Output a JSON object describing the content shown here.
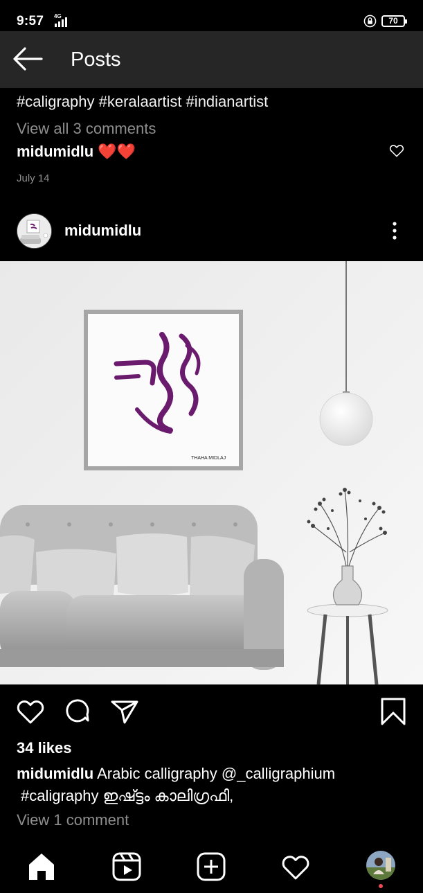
{
  "status_bar": {
    "time": "9:57",
    "network": "4G",
    "battery": "70"
  },
  "header": {
    "title": "Posts",
    "back_icon": "arrow-left-icon"
  },
  "previous_post": {
    "caption_tail": "#caligraphy #keralaartist #indianartist",
    "view_comments": "View all 3 comments",
    "comment_user": "midumidlu",
    "comment_text": "❤️❤️",
    "date": "July 14"
  },
  "post": {
    "username": "midumidlu",
    "image_signature": "THAHA MIDLAJ",
    "likes": "34 likes",
    "caption_user": "midumidlu",
    "caption_text": "Arabic calligraphy @_calligraphium",
    "caption_line2": "#caligraphy ഇഷ്ട്ടം കാലിഗ്രഫി,",
    "view_comment": "View 1 comment",
    "actions": [
      "heart-icon",
      "comment-icon",
      "share-icon",
      "bookmark-icon"
    ]
  },
  "bottom_nav": {
    "items": [
      "home-icon",
      "reels-icon",
      "new-post-icon",
      "activity-icon",
      "profile-avatar"
    ],
    "notification_color": "#ed4956"
  },
  "colors": {
    "background": "#000000",
    "header": "#262626",
    "muted_text": "#8e8e8e",
    "heart_red": "#ed4956",
    "calligraphy_purple": "#6a1b6e"
  }
}
